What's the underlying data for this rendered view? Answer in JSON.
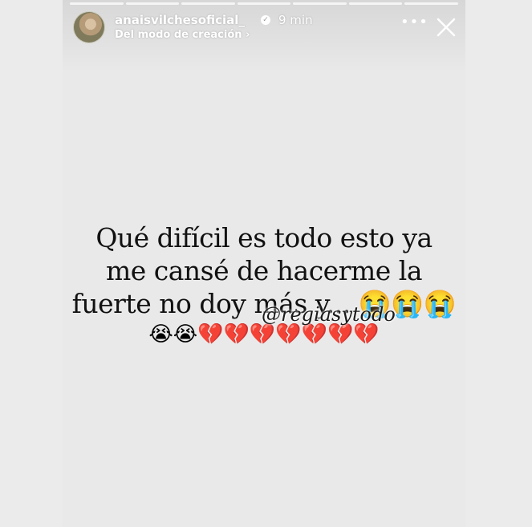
{
  "header": {
    "username": "anaisvilchesoficial_",
    "time": "9 min",
    "subtitle": "Del modo de creación",
    "chevron": "›",
    "more": "•••",
    "icons": {
      "verified": "verified-badge-icon",
      "more": "more-options-icon",
      "close": "close-icon"
    }
  },
  "progress": {
    "segments": 7,
    "current_segment": 1
  },
  "story": {
    "lines": [
      "Qué difícil es todo esto ya",
      "me cansé de hacerme la",
      "fuerte no doy más y... 😭😭😭"
    ],
    "emoji_line": "😭😭💔💔💔💔💔💔💔",
    "watermark": "@regiasytodo"
  },
  "colors": {
    "background": "#e9e9e9",
    "text": "#111111",
    "ui_text": "#ffffff"
  }
}
